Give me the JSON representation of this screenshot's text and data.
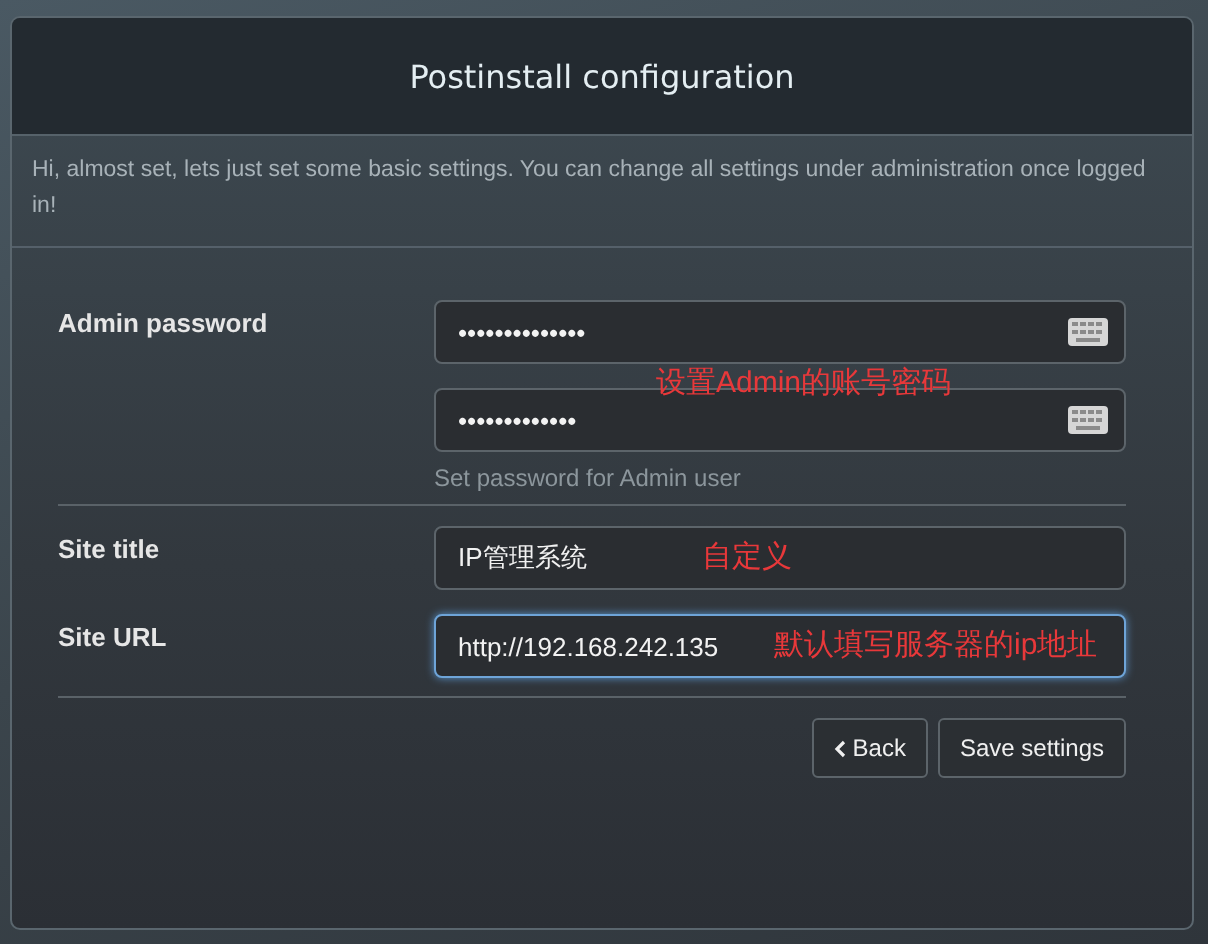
{
  "dialog": {
    "title": "Postinstall configuration",
    "intro": "Hi, almost set, lets just set some basic settings. You can change all settings under administration once logged in!"
  },
  "sections": [
    {
      "label": "Admin password",
      "fields": [
        {
          "kind": "password",
          "value": "••••••••••••••",
          "focused": false
        },
        {
          "kind": "password",
          "value": "•••••••••••••",
          "focused": false
        }
      ],
      "help": "Set password for Admin user",
      "annotation": "设置Admin的账号密码"
    },
    {
      "label": "Site title",
      "fields": [
        {
          "kind": "text",
          "value": "IP管理系统",
          "focused": false,
          "annotation": "自定义"
        }
      ]
    },
    {
      "label": "Site URL",
      "fields": [
        {
          "kind": "text",
          "value": "http://192.168.242.135",
          "focused": true,
          "annotation": "默认填写服务器的ip地址"
        }
      ]
    }
  ],
  "buttons": [
    {
      "kind": "back",
      "label": "Back"
    },
    {
      "kind": "primary",
      "label": "Save settings"
    }
  ]
}
